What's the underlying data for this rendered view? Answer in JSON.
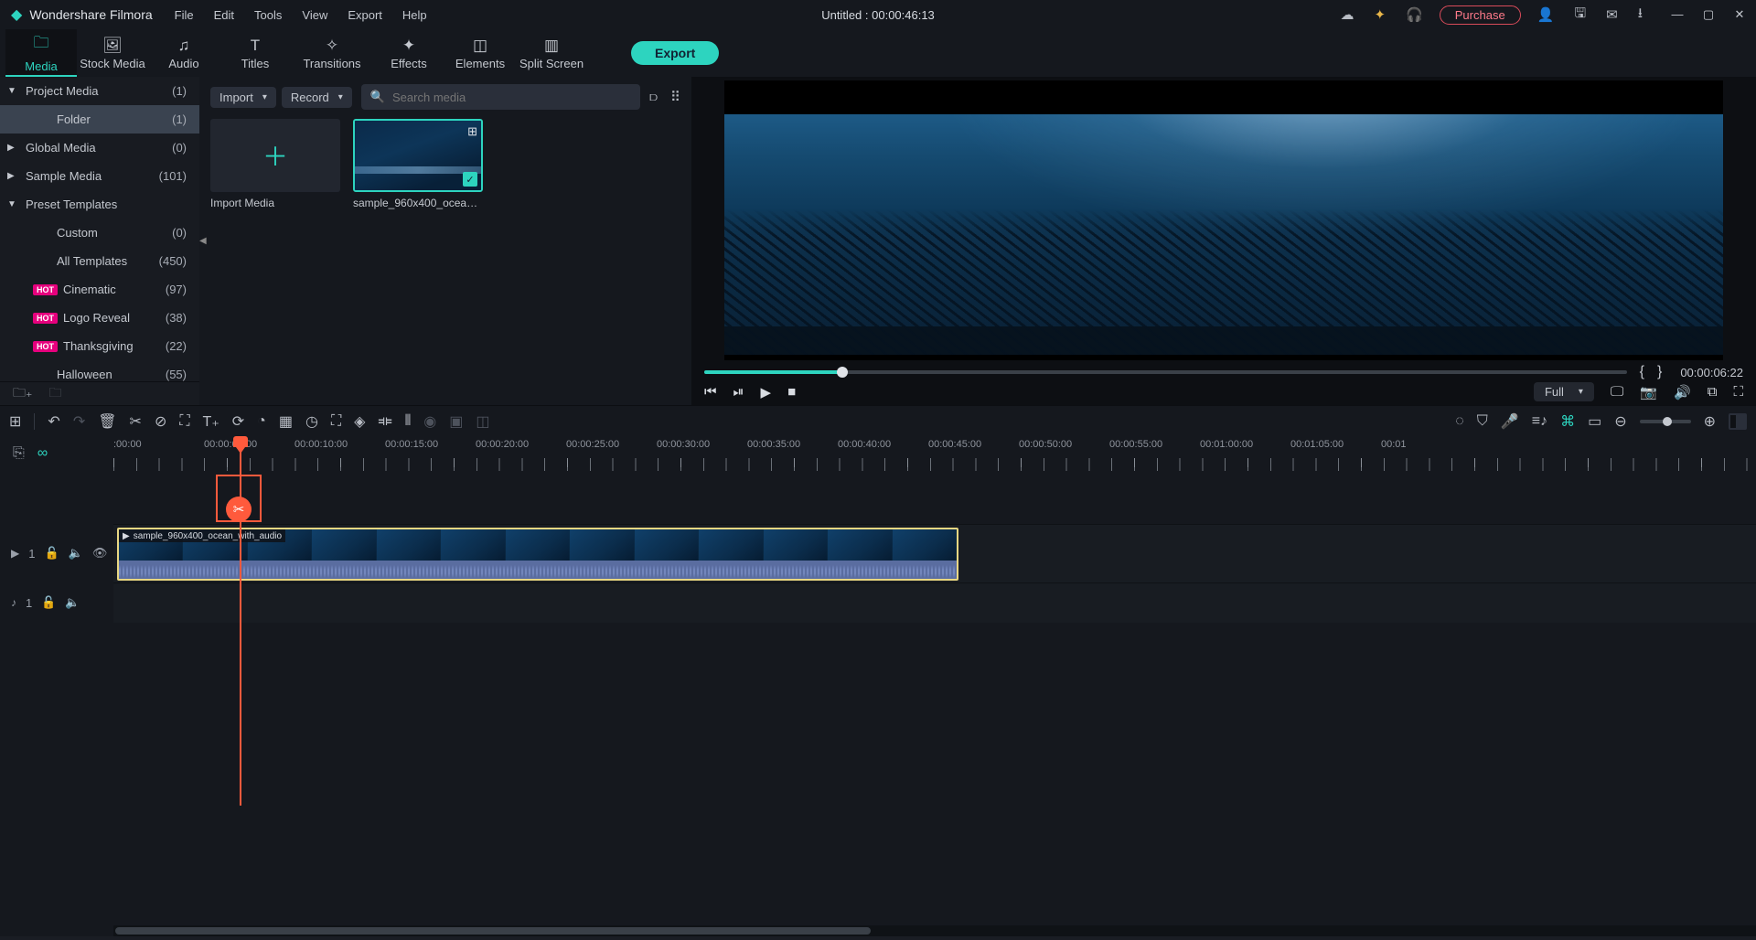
{
  "app": {
    "name": "Wondershare Filmora",
    "title": "Untitled : 00:00:46:13",
    "purchase": "Purchase"
  },
  "menu": [
    "File",
    "Edit",
    "Tools",
    "View",
    "Export",
    "Help"
  ],
  "tabs": [
    {
      "label": "Media",
      "active": true
    },
    {
      "label": "Stock Media"
    },
    {
      "label": "Audio"
    },
    {
      "label": "Titles"
    },
    {
      "label": "Transitions"
    },
    {
      "label": "Effects"
    },
    {
      "label": "Elements"
    },
    {
      "label": "Split Screen"
    }
  ],
  "export": "Export",
  "tree": {
    "project": {
      "label": "Project Media",
      "count": "(1)"
    },
    "folder": {
      "label": "Folder",
      "count": "(1)"
    },
    "global": {
      "label": "Global Media",
      "count": "(0)"
    },
    "sample": {
      "label": "Sample Media",
      "count": "(101)"
    },
    "preset": {
      "label": "Preset Templates"
    },
    "custom": {
      "label": "Custom",
      "count": "(0)"
    },
    "alltpl": {
      "label": "All Templates",
      "count": "(450)"
    },
    "cinematic": {
      "label": "Cinematic",
      "count": "(97)"
    },
    "logo": {
      "label": "Logo Reveal",
      "count": "(38)"
    },
    "thanks": {
      "label": "Thanksgiving",
      "count": "(22)"
    },
    "hallo": {
      "label": "Halloween",
      "count": "(55)"
    },
    "hot": "HOT"
  },
  "browser": {
    "import": "Import",
    "record": "Record",
    "search_ph": "Search media",
    "import_media": "Import Media",
    "clip": "sample_960x400_ocean_..."
  },
  "preview": {
    "timecode": "00:00:06:22",
    "quality": "Full"
  },
  "ruler": [
    ":00:00",
    "00:00:05:00",
    "00:00:10:00",
    "00:00:15:00",
    "00:00:20:00",
    "00:00:25:00",
    "00:00:30:00",
    "00:00:35:00",
    "00:00:40:00",
    "00:00:45:00",
    "00:00:50:00",
    "00:00:55:00",
    "00:01:00:00",
    "00:01:05:00",
    "00:01"
  ],
  "track": {
    "video_name": "1",
    "audio_name": "1",
    "clip_name": "sample_960x400_ocean_with_audio"
  }
}
